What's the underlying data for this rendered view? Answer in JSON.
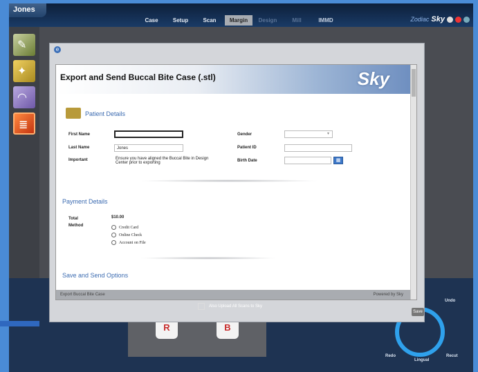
{
  "topbar": {
    "user": "Jones",
    "tabs": [
      {
        "label": "Case",
        "state": "normal"
      },
      {
        "label": "Setup",
        "state": "normal"
      },
      {
        "label": "Scan",
        "state": "normal"
      },
      {
        "label": "Margin",
        "state": "active"
      },
      {
        "label": "Design",
        "state": "dim"
      },
      {
        "label": "Mill",
        "state": "dim"
      },
      {
        "label": "IMMD",
        "state": "dark"
      }
    ],
    "brand_prefix": "Zodiac",
    "brand": "Sky"
  },
  "modal": {
    "title": "Export and Send Buccal Bite Case (.stl)",
    "logo": "Sky",
    "patient_section": "Patient Details",
    "labels": {
      "first_name": "First Name",
      "last_name": "Last Name",
      "important": "Important",
      "gender": "Gender",
      "patient_id": "Patient ID",
      "birth_date": "Birth Date"
    },
    "values": {
      "first_name": "",
      "last_name": "Jones",
      "important": "Ensure you have aligned the Buccal Bite in Design Center prior to exporting",
      "gender": "",
      "patient_id": "",
      "birth_date": ""
    },
    "payment_section": "Payment Details",
    "total_label": "Total",
    "total_value": "$10.00",
    "method_label": "Method",
    "methods": [
      "Credit Card",
      "Online Check",
      "Account on File"
    ],
    "save_section": "Save and Send Options",
    "footer_left": "Export Buccal Bite Case",
    "footer_right": "Powered by Sky",
    "upload_label": "Also Upload All Scans to Sky",
    "button": "Save"
  },
  "wheel": {
    "labels": [
      "Undo",
      "Recut",
      "Lingual",
      "Redo"
    ]
  },
  "colors": {
    "accent": "#3a6ab0",
    "frame": "#4a8bd6",
    "active_tab": "#a8acb2"
  }
}
